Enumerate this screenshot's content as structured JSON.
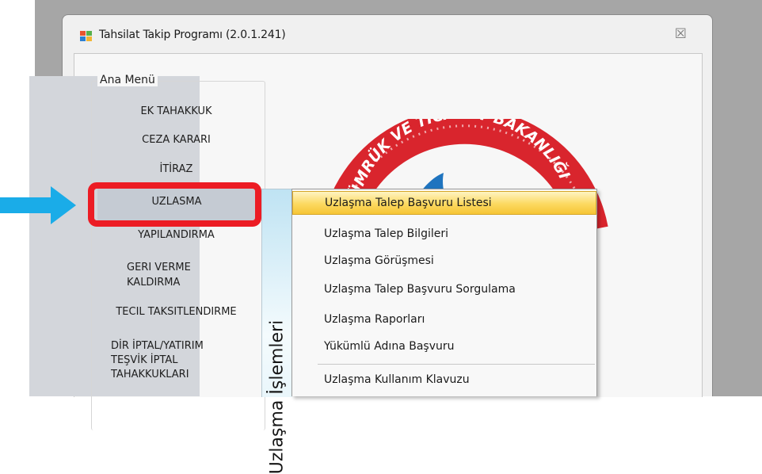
{
  "window": {
    "title": "Tahsilat Takip Programı (2.0.1.241)",
    "close_symbol": "☒"
  },
  "main_menu": {
    "group_title": "Ana Menü",
    "items": [
      {
        "label": "EK TAHAKKUK"
      },
      {
        "label": "CEZA KARARI"
      },
      {
        "label": "İTİRAZ"
      },
      {
        "label": "UZLASMA",
        "selected": true
      },
      {
        "label": "YAPILANDIRMA"
      },
      {
        "label": "GERI VERME KALDIRMA"
      },
      {
        "label": "TECIL TAKSITLENDIRME"
      },
      {
        "label": "DİR İPTAL/YATIRIM TEŞVİK İPTAL TAHAKKUKLARI"
      }
    ]
  },
  "logo": {
    "text": "GÜMRÜK VE TİCARET BAKANLIĞI",
    "ring_color": "#d9252d",
    "inner_color": "#1f74bf"
  },
  "annotation": {
    "arrow_color": "#1aace8",
    "box_color": "#ec1c24"
  },
  "submenu": {
    "vertical_label": "Uzlaşma İşlemleri",
    "items": [
      {
        "label": "Uzlaşma Talep Başvuru Listesi",
        "highlighted": true
      },
      {
        "label": "Uzlaşma Talep Bilgileri"
      },
      {
        "label": "Uzlaşma Görüşmesi"
      },
      {
        "label": "Uzlaşma Talep Başvuru Sorgulama"
      },
      {
        "label": "Uzlaşma Raporları"
      },
      {
        "label": "Yükümlü Adına Başvuru"
      },
      {
        "label": "Uzlaşma Kullanım Klavuzu"
      }
    ]
  }
}
